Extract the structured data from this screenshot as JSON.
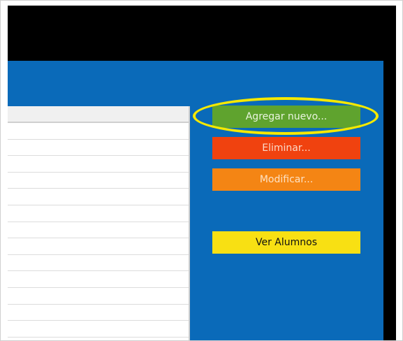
{
  "buttons": {
    "add_label": "Agregar nuevo...",
    "delete_label": "Eliminar...",
    "modify_label": "Modificar...",
    "view_students_label": "Ver Alumnos"
  },
  "grid": {
    "visible_rows": 13
  },
  "colors": {
    "titlebar": "#000000",
    "panel": "#0a6ab9",
    "add_button": "#5fa32e",
    "delete_button": "#f0420f",
    "modify_button": "#f48514",
    "view_button": "#f8e013",
    "highlight": "#f5e800"
  }
}
